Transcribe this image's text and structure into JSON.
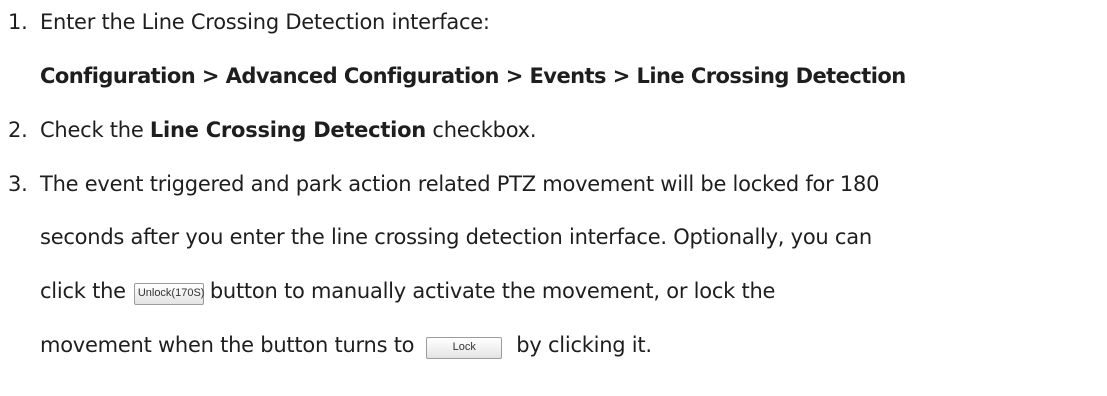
{
  "steps": [
    {
      "number": "1.",
      "text": "Enter the Line Crossing Detection interface:",
      "path": "Configuration > Advanced Configuration > Events > Line Crossing Detection"
    },
    {
      "number": "2.",
      "pre": "Check the ",
      "bold": "Line Crossing Detection",
      "post": " checkbox."
    },
    {
      "number": "3.",
      "line1": "The event triggered and park action related PTZ movement will be locked for 180",
      "line2": "seconds after you enter the line crossing detection interface. Optionally, you can",
      "line3_pre": "click the",
      "unlock_button": "Unlock(170S)",
      "line3_post": "button to manually activate the movement, or lock the",
      "line4_pre": "movement when the button turns to",
      "lock_button": "Lock",
      "line4_post": "by clicking it."
    }
  ]
}
